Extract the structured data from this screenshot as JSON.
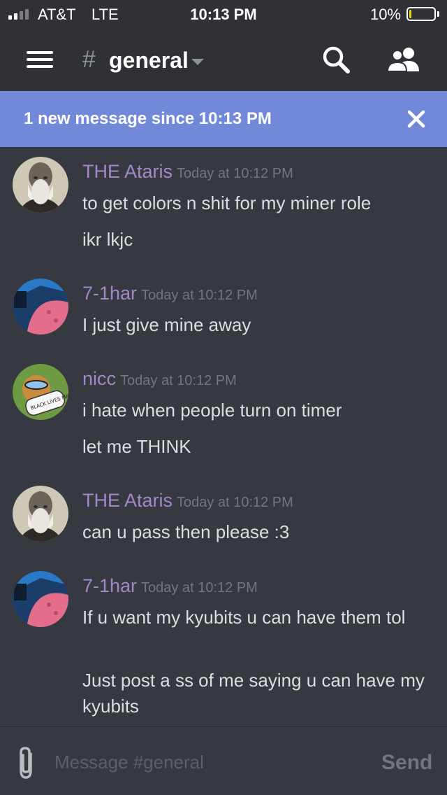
{
  "status_bar": {
    "carrier": "AT&T",
    "network": "LTE",
    "time": "10:13 PM",
    "battery_percent": "10%",
    "battery_level": 0.1,
    "signal_bars_active": 2,
    "signal_bars_total": 4
  },
  "header": {
    "channel_prefix": "#",
    "channel_name": "general",
    "icons": [
      "hamburger-menu-icon",
      "search-icon",
      "members-icon"
    ]
  },
  "banner": {
    "text": "1 new message since 10:13 PM",
    "close_icon": "close-icon"
  },
  "messages": [
    {
      "username": "THE Ataris",
      "timestamp": "Today at 10:12 PM",
      "avatar": "bearded-man-avatar",
      "lines": [
        "to get colors n shit for my miner role",
        "ikr lkjc"
      ]
    },
    {
      "username": "7-1har",
      "timestamp": "Today at 10:12 PM",
      "avatar": "cartoon-starfish-avatar",
      "lines": [
        "I just give mine away"
      ]
    },
    {
      "username": "nicc",
      "timestamp": "Today at 10:12 PM",
      "avatar": "dog-with-sign-avatar",
      "avatar_sign_text": "BLACK LIVES MATTER",
      "lines": [
        "i hate when people turn on timer",
        "let me THINK"
      ]
    },
    {
      "username": "THE Ataris",
      "timestamp": "Today at 10:12 PM",
      "avatar": "bearded-man-avatar",
      "lines": [
        "can u pass then please :3"
      ]
    },
    {
      "username": "7-1har",
      "timestamp": "Today at 10:12 PM",
      "avatar": "cartoon-starfish-avatar",
      "lines": [
        "If u want my kyubits u can have them tol",
        "Just post a ss of me saying u can have my kyubits"
      ]
    }
  ],
  "composer": {
    "placeholder": "Message #general",
    "value": "",
    "send_label": "Send",
    "attach_icon": "paperclip-icon"
  },
  "colors": {
    "background": "#36393f",
    "header": "#2f3136",
    "banner": "#7289da",
    "username": "#a487c9",
    "timestamp": "#72767d",
    "message_text": "#dcddde",
    "battery_low": "#f5d50a"
  }
}
